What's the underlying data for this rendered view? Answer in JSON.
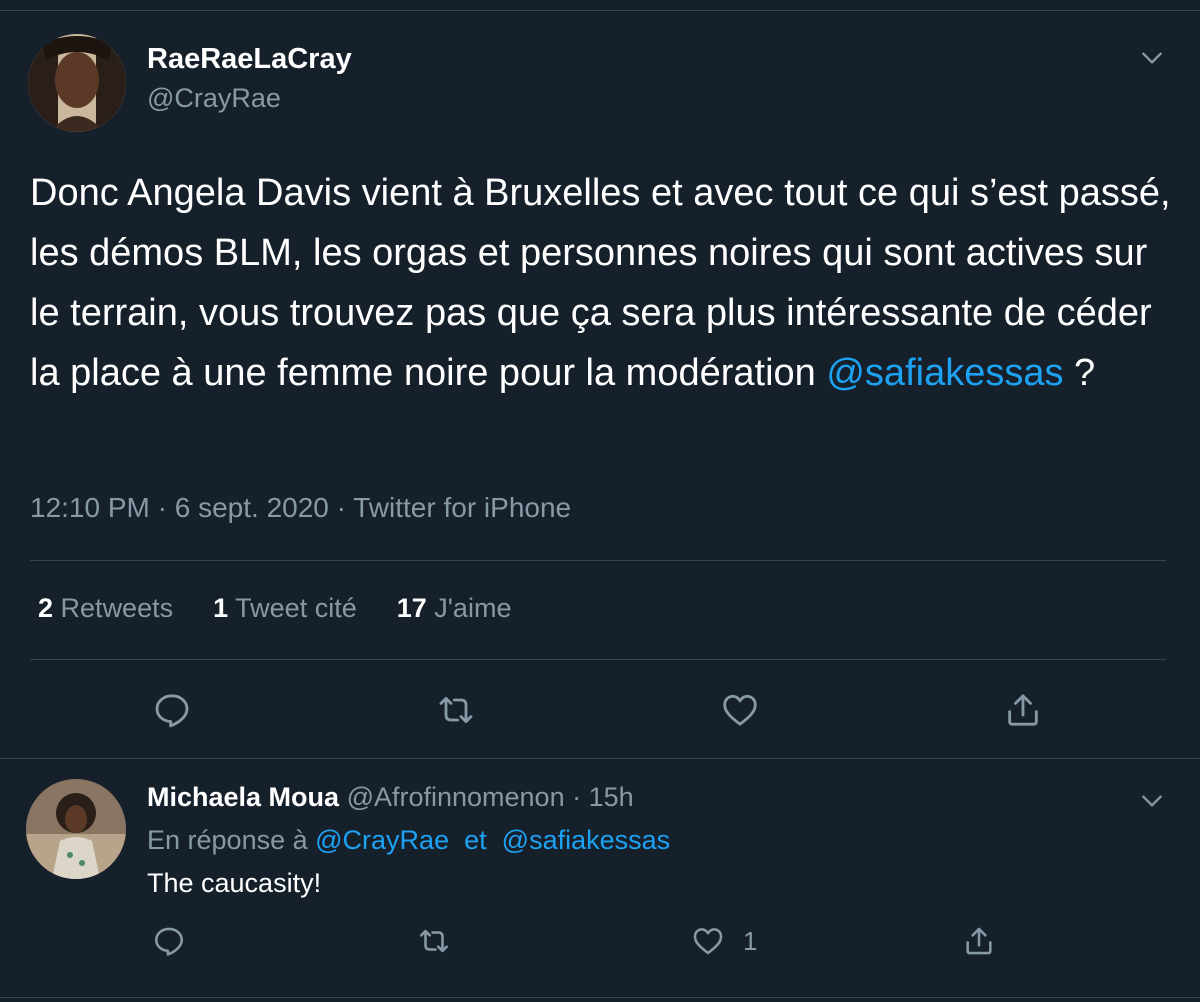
{
  "tweet": {
    "display_name": "RaeRaeLaCray",
    "handle": "@CrayRae",
    "text_before": "Donc Angela Davis vient à Bruxelles et avec tout ce qui s’est passé, les démos BLM, les orgas et personnes noires qui sont actives sur le terrain, vous trouvez pas que ça sera plus intéressante de céder la place à une femme noire pour la modération ",
    "mention": "@safiakessas",
    "text_after": " ?",
    "meta": "12:10 PM · 6 sept. 2020 · Twitter for iPhone",
    "stats": {
      "retweets_count": "2",
      "retweets_label": "Retweets",
      "quotes_count": "1",
      "quotes_label": "Tweet cité",
      "likes_count": "17",
      "likes_label": "J'aime"
    },
    "actions": [
      "reply-icon",
      "retweet-icon",
      "like-icon",
      "share-icon"
    ]
  },
  "reply": {
    "display_name": "Michaela Moua",
    "handle": "@Afrofinnomenon",
    "time_sep": " · ",
    "time": "15h",
    "in_reply_label": "En réponse à",
    "in_reply_user1": "@CrayRae",
    "in_reply_joiner": "et",
    "in_reply_user2": "@safiakessas",
    "text": "The caucasity!",
    "like_count": "1"
  },
  "colors": {
    "background": "#15202b",
    "text": "#ffffff",
    "secondary": "#8899a6",
    "accent": "#1da1f2",
    "divider": "#38444d"
  }
}
